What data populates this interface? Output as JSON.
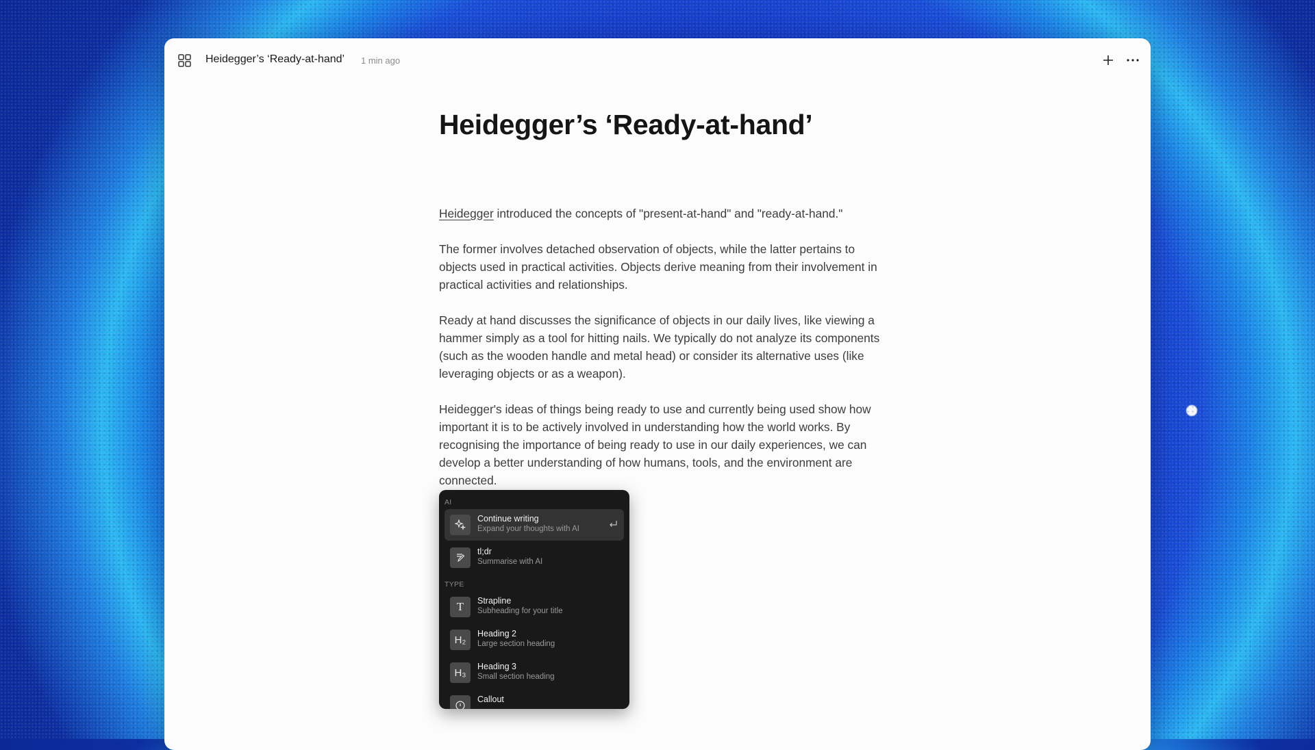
{
  "header": {
    "doc_title": "Heidegger’s ‘Ready-at-hand’",
    "timestamp": "1 min ago",
    "icons": [
      "grid-icon",
      "plus-icon",
      "more-icon"
    ]
  },
  "document": {
    "title": "Heidegger’s ‘Ready-at-hand’",
    "p1_link": "Heidegger",
    "p1_rest": " introduced the concepts of \"present-at-hand\" and \"ready-at-hand.\"",
    "p2": "The former involves detached observation of objects, while the latter pertains to  objects used in practical activities. Objects derive meaning from their involvement in practical activities and relationships.",
    "p3": "Ready at hand discusses the significance of objects in our daily lives, like viewing a hammer simply as a tool for hitting nails. We typically do not analyze its components (such as the wooden handle and metal head) or consider its alternative uses (like leveraging objects or as a weapon).",
    "p4": "Heidegger's ideas of things being ready to use and currently being used show how important it is to be actively involved in understanding how the world works. By recognising the importance of being ready to use in our daily experiences, we can develop a better understanding of how humans, tools, and the environment are connected.",
    "current_input": "/"
  },
  "command_menu": {
    "section_ai": "AI",
    "section_type": "TYPE",
    "items": [
      {
        "title": "Continue writing",
        "desc": "Expand your thoughts with AI",
        "icon": "sparkle-icon"
      },
      {
        "title": "tl;dr",
        "desc": "Summarise with AI",
        "icon": "summarise-icon"
      },
      {
        "title": "Strapline",
        "desc": "Subheading for your title",
        "icon": "text-t-icon",
        "glyph": "T"
      },
      {
        "title": "Heading 2",
        "desc": "Large section heading",
        "icon": "heading-2-icon",
        "glyph": "H₂"
      },
      {
        "title": "Heading 3",
        "desc": "Small section heading",
        "icon": "heading-3-icon",
        "glyph": "H₃"
      },
      {
        "title": "Callout",
        "desc": "",
        "icon": "callout-icon"
      }
    ]
  },
  "colors": {
    "accent_bg": "#1436c2",
    "menu_bg": "#191919",
    "window_bg": "#fcfcfc"
  }
}
